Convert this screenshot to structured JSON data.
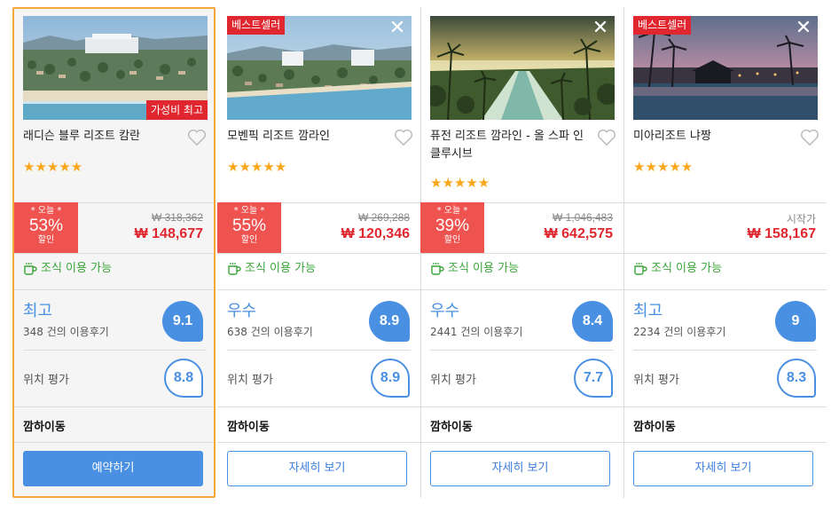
{
  "hotels": [
    {
      "name": "래디슨 블루 리조트 캄란",
      "tag": "가성비 최고",
      "tag_type": "value",
      "stars": "★★★★★",
      "discount_today": "* 오늘 *",
      "discount_pct": "53%",
      "discount_label": "할인",
      "original_price": "₩ 318,362",
      "price": "₩ 148,677",
      "breakfast": "조식 이용 가능",
      "rating_word": "최고",
      "reviews": "348 건의 이용후기",
      "score": "9.1",
      "location_label": "위치 평가",
      "location_score": "8.8",
      "area": "깜하이동",
      "button": "예약하기",
      "photo_style": "aerial"
    },
    {
      "name": "모벤픽 리조트 깜라인",
      "tag": "베스트셀러",
      "tag_type": "best",
      "stars": "★★★★★",
      "discount_today": "* 오늘 *",
      "discount_pct": "55%",
      "discount_label": "할인",
      "original_price": "₩ 269,288",
      "price": "₩ 120,346",
      "breakfast": "조식 이용 가능",
      "rating_word": "우수",
      "reviews": "638 건의 이용후기",
      "score": "8.9",
      "location_label": "위치 평가",
      "location_score": "8.9",
      "area": "깜하이동",
      "button": "자세히 보기",
      "photo_style": "aerial2"
    },
    {
      "name": "퓨전 리조트 깜라인 - 올 스파 인클루시브",
      "tag": "",
      "tag_type": "none",
      "stars": "★★★★★",
      "discount_today": "* 오늘 *",
      "discount_pct": "39%",
      "discount_label": "할인",
      "original_price": "₩ 1,046,483",
      "price": "₩ 642,575",
      "breakfast": "조식 이용 가능",
      "rating_word": "우수",
      "reviews": "2441 건의 이용후기",
      "score": "8.4",
      "location_label": "위치 평가",
      "location_score": "7.7",
      "area": "깜하이동",
      "button": "자세히 보기",
      "photo_style": "sunset"
    },
    {
      "name": "미아리조트 냐짱",
      "tag": "베스트셀러",
      "tag_type": "best",
      "stars": "★★★★★",
      "starting_label": "시작가",
      "price": "₩ 158,167",
      "breakfast": "조식 이용 가능",
      "rating_word": "최고",
      "reviews": "2234 건의 이용후기",
      "score": "9",
      "location_label": "위치 평가",
      "location_score": "8.3",
      "area": "깜하이동",
      "button": "자세히 보기",
      "photo_style": "pool"
    }
  ],
  "colors": {
    "accent_blue": "#4a90e2",
    "price_red": "#e0272f",
    "discount_red": "#ef5350",
    "breakfast_green": "#3aa43a",
    "star_orange": "#f9a61a",
    "selected_border": "#f5a53a"
  },
  "icons": {
    "close": "close-icon",
    "favorite": "heart-icon",
    "breakfast": "coffee-cup-icon"
  }
}
